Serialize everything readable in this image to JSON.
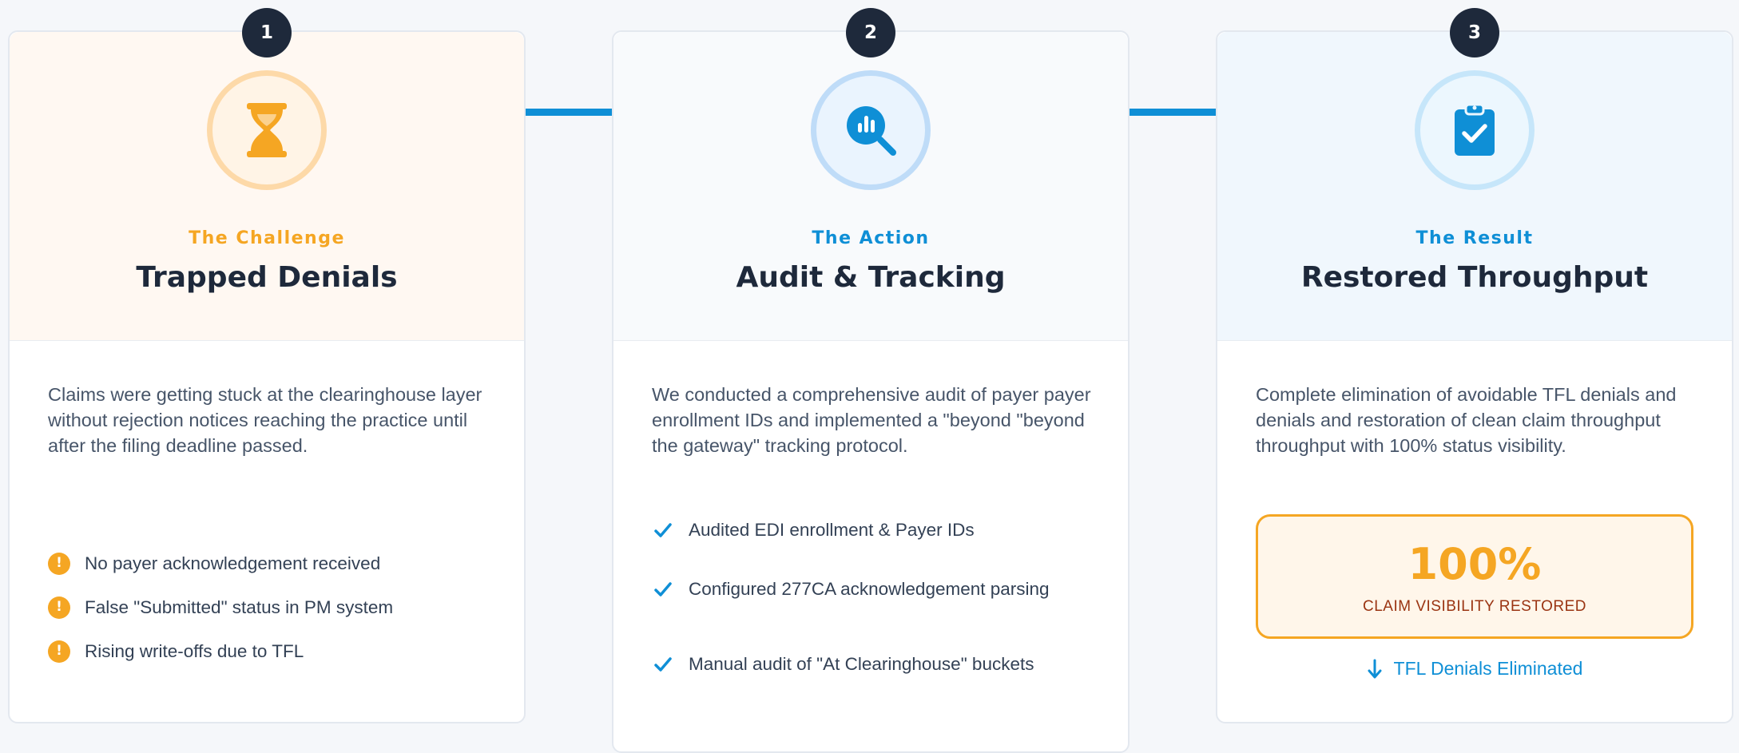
{
  "colors": {
    "dark": "#1e293b",
    "accent_blue": "#0f8fd6",
    "accent_orange": "#f5a623",
    "challenge_bg": "#fff8f2",
    "action_bg": "#f8fafc",
    "result_bg": "#f0f7fd"
  },
  "steps": [
    {
      "number": "1",
      "eyebrow": "The Challenge",
      "title": "Trapped Denials",
      "icon": "hourglass-icon",
      "description": "Claims were getting stuck at the clearinghouse layer without rejection notices reaching the practice until after the filing deadline passed.",
      "items": [
        "No payer acknowledgement received",
        "False \"Submitted\" status in PM system",
        "Rising write-offs due to TFL"
      ]
    },
    {
      "number": "2",
      "eyebrow": "The Action",
      "title": "Audit & Tracking",
      "icon": "search-chart-icon",
      "description": "We conducted a comprehensive audit of payer payer enrollment IDs and implemented a \"beyond \"beyond the gateway\" tracking protocol.",
      "items": [
        "Audited EDI enrollment & Payer IDs",
        "Configured 277CA acknowledgement parsing",
        "Manual audit of \"At Clearinghouse\" buckets"
      ]
    },
    {
      "number": "3",
      "eyebrow": "The Result",
      "title": "Restored Throughput",
      "icon": "clipboard-check-icon",
      "description": "Complete elimination of avoidable TFL denials and denials and restoration of clean claim throughput throughput with 100% status visibility.",
      "metric": {
        "value": "100%",
        "label": "CLAIM VISIBILITY RESTORED"
      },
      "footer": "TFL Denials Eliminated"
    }
  ]
}
